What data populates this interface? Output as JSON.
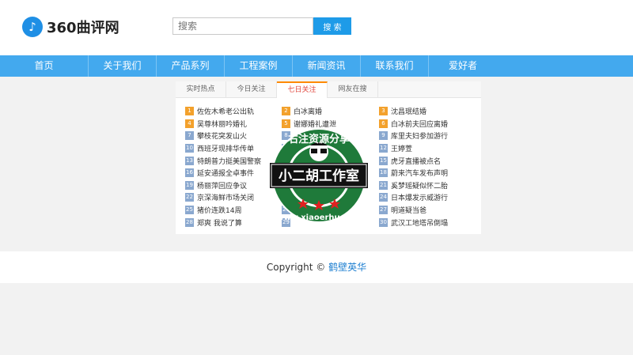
{
  "header": {
    "logo_glyph": "♪",
    "logo_text": "360曲评网",
    "search_placeholder": "搜索",
    "search_button": "搜 索"
  },
  "nav": [
    "首页",
    "关于我们",
    "产品系列",
    "工程案例",
    "新闻资讯",
    "联系我们",
    "爱好者"
  ],
  "tabs": [
    "实时热点",
    "今日关注",
    "七日关注",
    "网友在搜"
  ],
  "active_tab": 2,
  "hot_list": {
    "col1": [
      {
        "n": "1",
        "t": "佐佐木希老公出轨"
      },
      {
        "n": "4",
        "t": "吴尊林丽吟婚礼"
      },
      {
        "n": "7",
        "t": "攀枝花突发山火"
      },
      {
        "n": "10",
        "t": "西班牙现排华传单"
      },
      {
        "n": "13",
        "t": "特朗普力挺美国警察"
      },
      {
        "n": "16",
        "t": "延安通报全卓事件"
      },
      {
        "n": "19",
        "t": "杨丽萍回应争议"
      },
      {
        "n": "22",
        "t": "京深海鲜市场关闭"
      },
      {
        "n": "25",
        "t": "猪价连跌14周"
      },
      {
        "n": "28",
        "t": "郑爽 我说了算"
      }
    ],
    "col2": [
      {
        "n": "2",
        "t": "白冰离婚"
      },
      {
        "n": "5",
        "t": "谢娜婚礼遭泄"
      },
      {
        "n": "8",
        "t": ""
      },
      {
        "n": "11",
        "t": ""
      },
      {
        "n": "14",
        "t": "黄奕回应"
      },
      {
        "n": "17",
        "t": ""
      },
      {
        "n": "20",
        "t": ""
      },
      {
        "n": "23",
        "t": ""
      },
      {
        "n": "26",
        "t": ""
      },
      {
        "n": "29",
        "t": ""
      }
    ],
    "col3": [
      {
        "n": "3",
        "t": "沈昌珉结婚"
      },
      {
        "n": "6",
        "t": "白冰前夫回应离婚"
      },
      {
        "n": "9",
        "t": "库里夫妇参加游行"
      },
      {
        "n": "12",
        "t": "王婷萱"
      },
      {
        "n": "15",
        "t": "虎牙直播被点名"
      },
      {
        "n": "18",
        "t": "蔚来汽车发布声明"
      },
      {
        "n": "21",
        "t": "奚梦瑶疑似怀二胎"
      },
      {
        "n": "24",
        "t": "日本爆发示威游行"
      },
      {
        "n": "27",
        "t": "明道疑当爸"
      },
      {
        "n": "30",
        "t": "武汉工地塔吊倒塌"
      }
    ]
  },
  "footer": {
    "copyright": "Copyright ©",
    "owner": "鹤壁英华"
  },
  "watermark": {
    "top_text": "右注资源分享",
    "center_text": "小二胡工作室",
    "bottom_text": "www.xiaoerhu.com",
    "green": "#1f7a3a",
    "red": "#e02020"
  }
}
